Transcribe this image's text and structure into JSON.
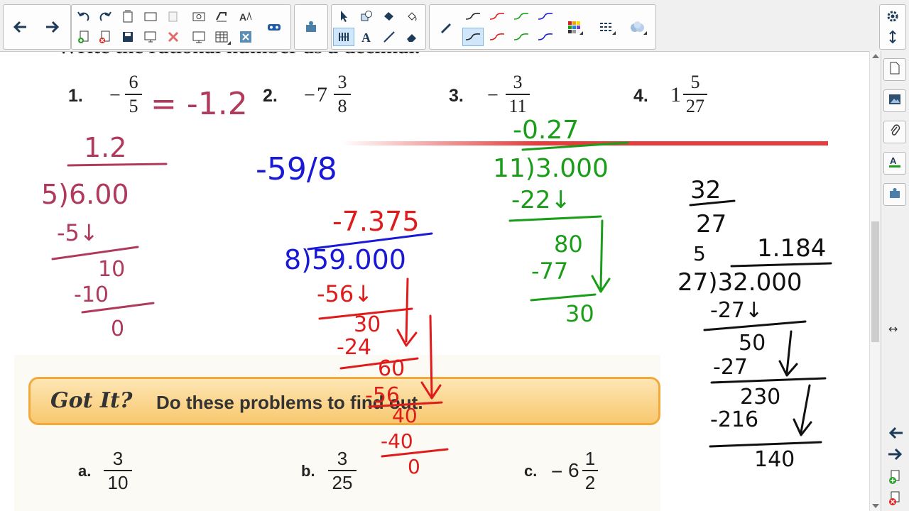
{
  "toolbar": {
    "colors": {
      "accent": "#1e5aa8",
      "red": "#e01b1b",
      "green": "#1a9e1a",
      "blue": "#1a1ad6"
    },
    "icons": [
      "back-arrow-icon",
      "forward-arrow-icon",
      "undo-icon",
      "redo-icon",
      "page-sorter-icon",
      "screen-shade-icon",
      "paste-icon",
      "screen-capture-icon",
      "ink-aware-icon",
      "spell-icon",
      "add-page-icon",
      "delete-page-icon",
      "save-icon",
      "display-icon",
      "delete-icon",
      "fullscreen-icon",
      "table-icon",
      "close-window-icon",
      "gallery-icon",
      "puzzle-icon",
      "select-icon",
      "shapes-icon",
      "fill-icon",
      "eraser-icon",
      "text-icon",
      "line-icon",
      "pen-icon",
      "color-icon",
      "properties-icon",
      "cloud-icon",
      "settings-icon",
      "toolbar-toggle-icon"
    ]
  },
  "sidebar": {
    "icons": [
      "page-sorter-icon",
      "gallery-icon",
      "attachments-icon",
      "properties-icon",
      "add-ons-icon",
      "resize-icon",
      "prev-page-icon",
      "next-page-icon",
      "add-page-icon",
      "delete-page-icon"
    ]
  },
  "page": {
    "top_text": "Write the rational number as a decimal.",
    "problems": [
      {
        "label": "1.",
        "sign": "−",
        "numerator": "6",
        "denominator": "5"
      },
      {
        "label": "2.",
        "sign": "−",
        "whole": "7",
        "numerator": "3",
        "denominator": "8"
      },
      {
        "label": "3.",
        "sign": "−",
        "numerator": "3",
        "denominator": "11"
      },
      {
        "label": "4.",
        "sign": "",
        "whole": "1",
        "numerator": "5",
        "denominator": "27"
      }
    ],
    "got_it": {
      "title": "Got It?",
      "text": "Do these problems to find out."
    },
    "practice": [
      {
        "label": "a.",
        "numerator": "3",
        "denominator": "10"
      },
      {
        "label": "b.",
        "numerator": "3",
        "denominator": "25"
      },
      {
        "label": "c.",
        "sign": "−",
        "whole": "6",
        "numerator": "1",
        "denominator": "2"
      }
    ]
  },
  "handwriting": {
    "p1_answer": "= -1.2",
    "p1_work": [
      "1.2",
      "5)6.00",
      "-5↓",
      "10",
      "-10",
      "0"
    ],
    "p2_work": [
      "-59/8",
      "-7.375",
      "8)59.000",
      "-56↓",
      "30",
      "-24",
      "60",
      "-56",
      "40",
      "-40",
      "0"
    ],
    "p3_work": [
      "-0.27",
      "11)3.000",
      "-22↓",
      "80",
      "-77",
      "30"
    ],
    "p4_work": [
      "32/27",
      "5",
      "1.184",
      "27)32.000",
      "-27↓",
      "50",
      "-27",
      "230",
      "-216",
      "140"
    ]
  }
}
